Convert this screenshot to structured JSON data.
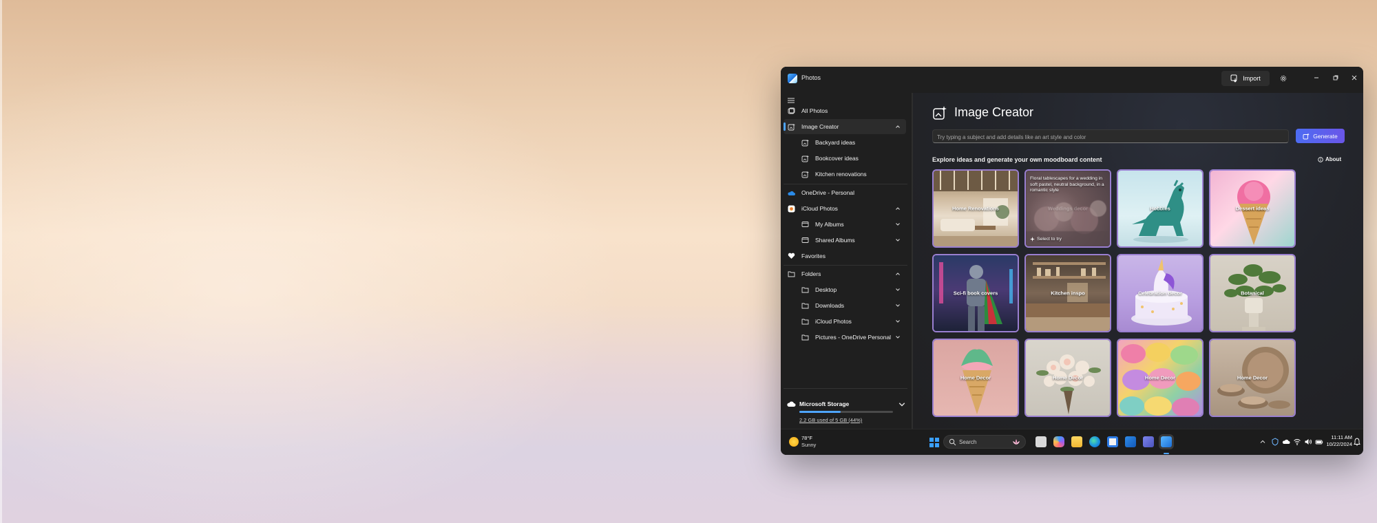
{
  "window": {
    "title": "Photos",
    "import_label": "Import",
    "icons": [
      "photos-app-icon",
      "import-icon",
      "gear-icon",
      "minimize-icon",
      "restore-icon",
      "close-icon"
    ]
  },
  "sidebar": {
    "items": [
      {
        "label": "All Photos",
        "icon": "photos-icon"
      },
      {
        "label": "Image Creator",
        "icon": "image-creator-icon",
        "selected": true,
        "expanded": true
      },
      {
        "label": "Backyard ideas",
        "icon": "image-creator-icon"
      },
      {
        "label": "Bookcover ideas",
        "icon": "image-creator-icon"
      },
      {
        "label": "Kitchen renovations",
        "icon": "image-creator-icon"
      },
      {
        "label": "OneDrive - Personal",
        "icon": "onedrive-icon"
      },
      {
        "label": "iCloud Photos",
        "icon": "icloud-icon",
        "expanded": true
      },
      {
        "label": "My Albums",
        "icon": "album-icon"
      },
      {
        "label": "Shared Albums",
        "icon": "album-icon"
      },
      {
        "label": "Favorites",
        "icon": "heart-icon"
      },
      {
        "label": "Folders",
        "icon": "folder-icon",
        "expanded": true
      },
      {
        "label": "Desktop",
        "icon": "folder-icon"
      },
      {
        "label": "Downloads",
        "icon": "folder-icon"
      },
      {
        "label": "iCloud Photos",
        "icon": "folder-icon"
      },
      {
        "label": "Pictures - OneDrive Personal",
        "icon": "folder-icon"
      }
    ],
    "storage": {
      "title": "Microsoft Storage",
      "used_text": "2.2 GB used of 5 GB (44%)",
      "used_fraction": 0.44,
      "accent": "#4ea5ff"
    }
  },
  "main": {
    "title": "Image Creator",
    "prompt_placeholder": "Try typing a subject and add details like an art style and color",
    "generate_label": "Generate",
    "explore_text": "Explore ideas and generate your own moodboard content",
    "about_label": "About",
    "featured_prompt": "Floral tablescapes for a wedding in soft pastel, neutral background, in a romantic style",
    "select_to_try": "Select to try",
    "tiles": [
      {
        "label": "Home Renovations"
      },
      {
        "label": "Weddings decor"
      },
      {
        "label": "Hobbies"
      },
      {
        "label": "Dessert ideas"
      },
      {
        "label": "Sci-fi book covers"
      },
      {
        "label": "Kitchen inspo"
      },
      {
        "label": "Celebration decor"
      },
      {
        "label": "Botanical"
      },
      {
        "label": "Home Decor"
      },
      {
        "label": "Home Decor"
      },
      {
        "label": "Home Decor"
      },
      {
        "label": "Home Decor"
      }
    ]
  },
  "taskbar": {
    "weather_temp": "78°F",
    "weather_condition": "Sunny",
    "search_label": "Search",
    "time": "11:11 AM",
    "date": "10/22/2024"
  },
  "colors": {
    "accent": "#4ea5ff",
    "generate_gradient": [
      "#4d6cf2",
      "#6a56e8"
    ],
    "window_bg": "#202020"
  }
}
